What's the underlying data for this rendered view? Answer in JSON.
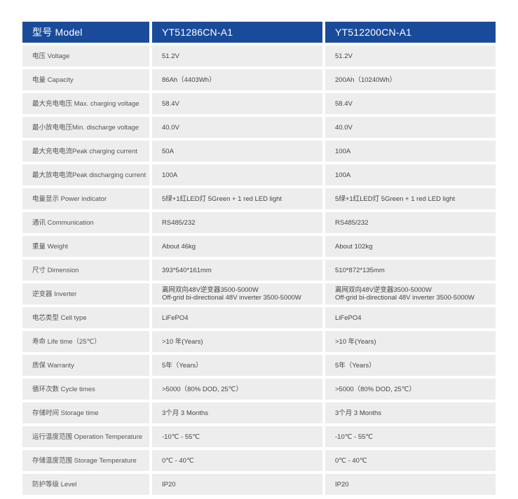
{
  "header": {
    "label": "型号 Model",
    "models": [
      "YT51286CN-A1",
      "YT512200CN-A1"
    ]
  },
  "colors": {
    "header_bg": "#1a4b9a",
    "row_bg": "#ededed"
  },
  "rows": [
    {
      "label": "电压 Voltage",
      "values": [
        [
          "51.2V"
        ],
        [
          "51.2V"
        ]
      ]
    },
    {
      "label": "电量 Capacity",
      "values": [
        [
          "86Ah（4403Wh）"
        ],
        [
          "200Ah（10240Wh）"
        ]
      ]
    },
    {
      "label": "最大充电电压 Max. charging voltage",
      "values": [
        [
          "58.4V"
        ],
        [
          "58.4V"
        ]
      ]
    },
    {
      "label": "最小放电电压Min. discharge voltage",
      "values": [
        [
          "40.0V"
        ],
        [
          "40.0V"
        ]
      ]
    },
    {
      "label": "最大充电电流Peak charging current",
      "values": [
        [
          "50A"
        ],
        [
          "100A"
        ]
      ]
    },
    {
      "label": "最大放电电流Peak discharging current",
      "values": [
        [
          "100A"
        ],
        [
          "100A"
        ]
      ]
    },
    {
      "label": "电量显示 Power indicator",
      "values": [
        [
          "5绿+1红LED灯  5Green + 1 red LED light"
        ],
        [
          "5绿+1红LED灯  5Green + 1 red LED light"
        ]
      ]
    },
    {
      "label": "通讯 Communication",
      "values": [
        [
          "RS485/232"
        ],
        [
          "RS485/232"
        ]
      ]
    },
    {
      "label": "重量 Weight",
      "values": [
        [
          "About 46kg"
        ],
        [
          "About 102kg"
        ]
      ]
    },
    {
      "label": "尺寸 Dimension",
      "values": [
        [
          "393*540*161mm"
        ],
        [
          "510*872*135mm"
        ]
      ]
    },
    {
      "label": "逆变器 Inverter",
      "values": [
        [
          "离网双向48V逆变器3500-5000W",
          "Off-grid bi-directional 48V inverter 3500-5000W"
        ],
        [
          "离网双向48V逆变器3500-5000W",
          "Off-grid bi-directional 48V inverter 3500-5000W"
        ]
      ]
    },
    {
      "label": "电芯类型 Cell type",
      "values": [
        [
          "LiFePO4"
        ],
        [
          "LiFePO4"
        ]
      ]
    },
    {
      "label": "寿命 Life time（25℃）",
      "values": [
        [
          ">10 年(Years)"
        ],
        [
          ">10 年(Years)"
        ]
      ]
    },
    {
      "label": "质保 Warranty",
      "values": [
        [
          "5年（Years）"
        ],
        [
          "5年（Years）"
        ]
      ]
    },
    {
      "label": "循环次数 Cycle times",
      "values": [
        [
          ">5000（80% DOD, 25℃）"
        ],
        [
          ">5000（80% DOD, 25℃）"
        ]
      ]
    },
    {
      "label": "存储时间 Storage time",
      "values": [
        [
          "3个月   3 Months"
        ],
        [
          "3个月   3 Months"
        ]
      ]
    },
    {
      "label": "运行温度范围 Operation Temperature",
      "values": [
        [
          "-10℃  - 55℃"
        ],
        [
          "-10℃  - 55℃"
        ]
      ]
    },
    {
      "label": "存储温度范围 Storage Temperature",
      "values": [
        [
          "0℃  - 40℃"
        ],
        [
          "0℃  - 40℃"
        ]
      ]
    },
    {
      "label": "防护等级 Level",
      "values": [
        [
          "IP20"
        ],
        [
          "IP20"
        ]
      ]
    }
  ]
}
